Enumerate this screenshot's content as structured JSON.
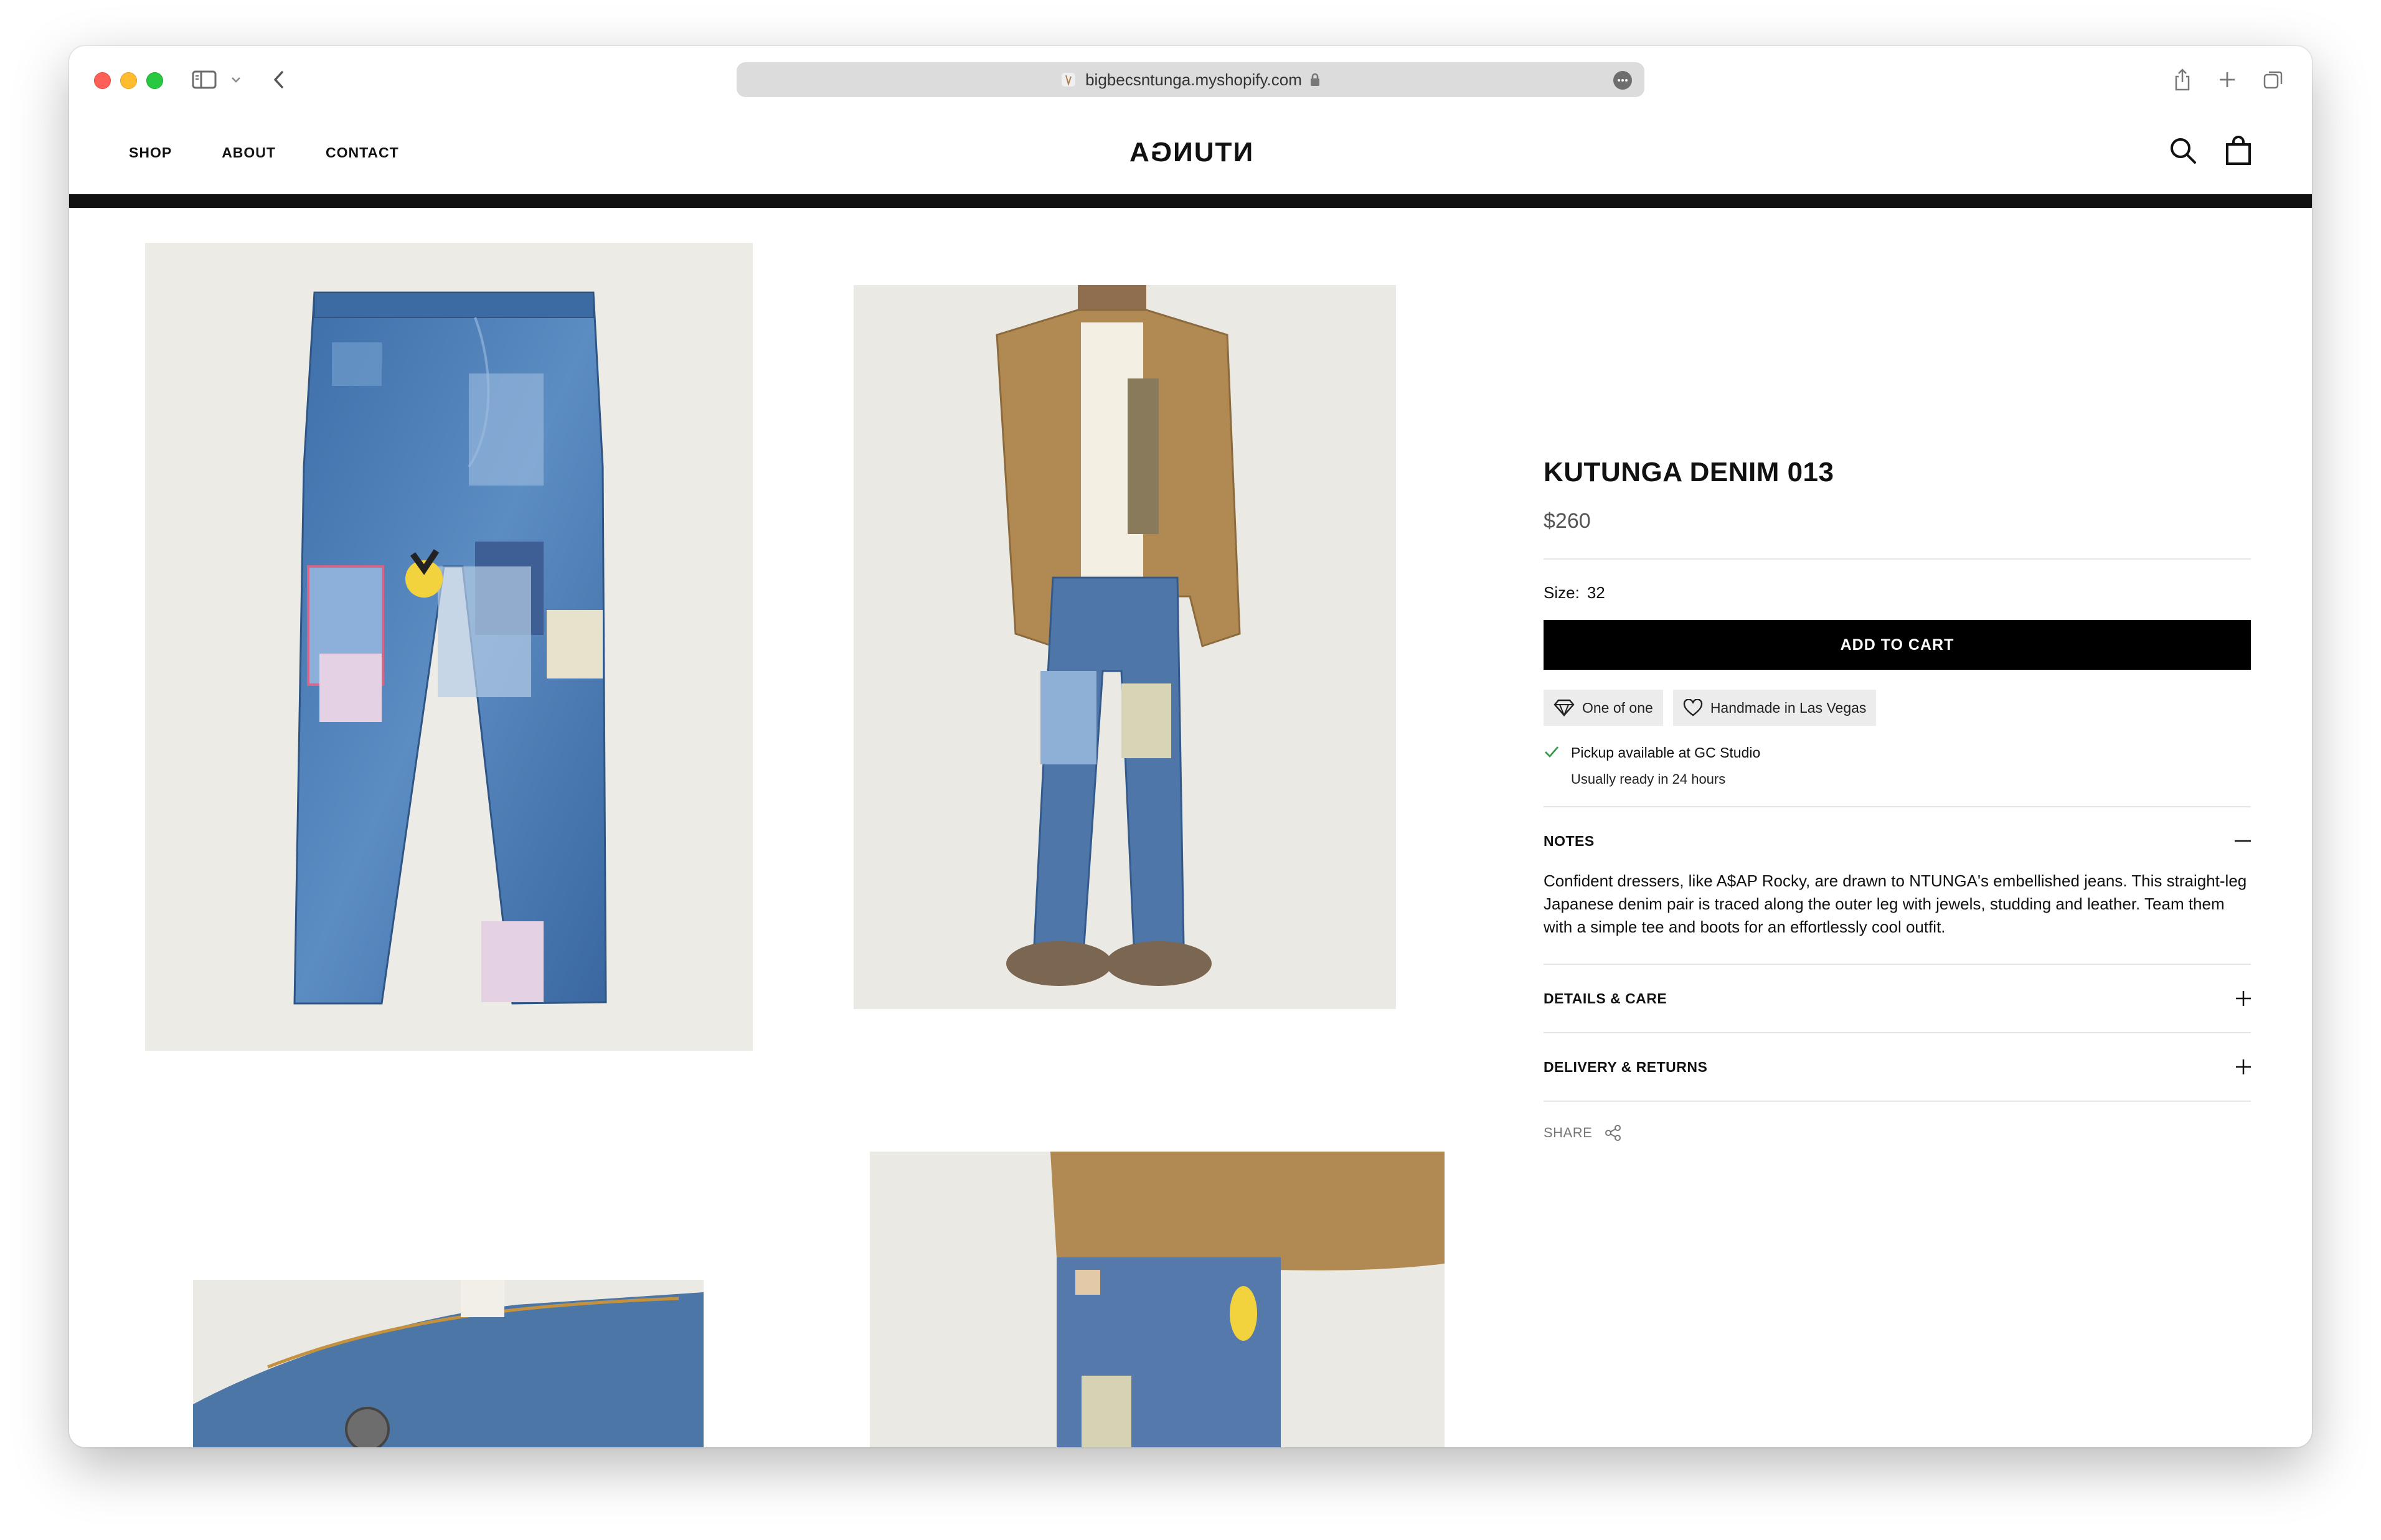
{
  "browser": {
    "url": "bigbecsntunga.myshopify.com"
  },
  "site": {
    "nav": [
      "SHOP",
      "ABOUT",
      "CONTACT"
    ],
    "logo": "NTUNGA"
  },
  "product": {
    "title": "KUTUNGA DENIM 013",
    "price": "$260",
    "size_label": "Size:",
    "size_value": "32",
    "add_to_cart": "ADD TO CART",
    "badges": [
      "One of one",
      "Handmade in Las Vegas"
    ],
    "pickup_line1": "Pickup available at GC Studio",
    "pickup_line2": "Usually ready in 24 hours",
    "notes_label": "NOTES",
    "notes_text": "Confident dressers, like A$AP Rocky, are drawn to NTUNGA's embellished jeans. This straight-leg Japanese denim pair is traced along the outer leg with jewels, studding and leather. Team them with a simple tee and boots for an effortlessly cool outfit.",
    "details_label": "DETAILS & CARE",
    "delivery_label": "DELIVERY & RETURNS",
    "share_label": "SHARE"
  }
}
